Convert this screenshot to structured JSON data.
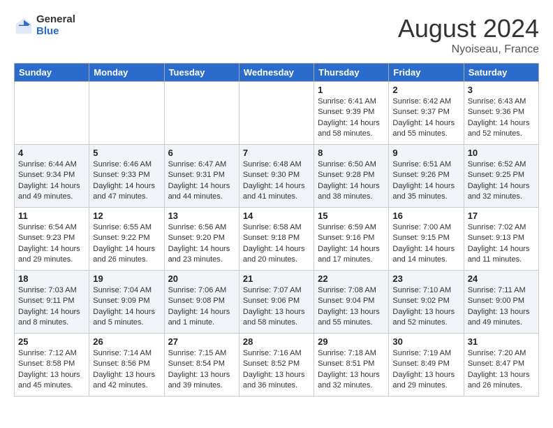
{
  "header": {
    "logo_general": "General",
    "logo_blue": "Blue",
    "month_year": "August 2024",
    "location": "Nyoiseau, France"
  },
  "weekdays": [
    "Sunday",
    "Monday",
    "Tuesday",
    "Wednesday",
    "Thursday",
    "Friday",
    "Saturday"
  ],
  "weeks": [
    [
      {
        "day": "",
        "info": ""
      },
      {
        "day": "",
        "info": ""
      },
      {
        "day": "",
        "info": ""
      },
      {
        "day": "",
        "info": ""
      },
      {
        "day": "1",
        "info": "Sunrise: 6:41 AM\nSunset: 9:39 PM\nDaylight: 14 hours\nand 58 minutes."
      },
      {
        "day": "2",
        "info": "Sunrise: 6:42 AM\nSunset: 9:37 PM\nDaylight: 14 hours\nand 55 minutes."
      },
      {
        "day": "3",
        "info": "Sunrise: 6:43 AM\nSunset: 9:36 PM\nDaylight: 14 hours\nand 52 minutes."
      }
    ],
    [
      {
        "day": "4",
        "info": "Sunrise: 6:44 AM\nSunset: 9:34 PM\nDaylight: 14 hours\nand 49 minutes."
      },
      {
        "day": "5",
        "info": "Sunrise: 6:46 AM\nSunset: 9:33 PM\nDaylight: 14 hours\nand 47 minutes."
      },
      {
        "day": "6",
        "info": "Sunrise: 6:47 AM\nSunset: 9:31 PM\nDaylight: 14 hours\nand 44 minutes."
      },
      {
        "day": "7",
        "info": "Sunrise: 6:48 AM\nSunset: 9:30 PM\nDaylight: 14 hours\nand 41 minutes."
      },
      {
        "day": "8",
        "info": "Sunrise: 6:50 AM\nSunset: 9:28 PM\nDaylight: 14 hours\nand 38 minutes."
      },
      {
        "day": "9",
        "info": "Sunrise: 6:51 AM\nSunset: 9:26 PM\nDaylight: 14 hours\nand 35 minutes."
      },
      {
        "day": "10",
        "info": "Sunrise: 6:52 AM\nSunset: 9:25 PM\nDaylight: 14 hours\nand 32 minutes."
      }
    ],
    [
      {
        "day": "11",
        "info": "Sunrise: 6:54 AM\nSunset: 9:23 PM\nDaylight: 14 hours\nand 29 minutes."
      },
      {
        "day": "12",
        "info": "Sunrise: 6:55 AM\nSunset: 9:22 PM\nDaylight: 14 hours\nand 26 minutes."
      },
      {
        "day": "13",
        "info": "Sunrise: 6:56 AM\nSunset: 9:20 PM\nDaylight: 14 hours\nand 23 minutes."
      },
      {
        "day": "14",
        "info": "Sunrise: 6:58 AM\nSunset: 9:18 PM\nDaylight: 14 hours\nand 20 minutes."
      },
      {
        "day": "15",
        "info": "Sunrise: 6:59 AM\nSunset: 9:16 PM\nDaylight: 14 hours\nand 17 minutes."
      },
      {
        "day": "16",
        "info": "Sunrise: 7:00 AM\nSunset: 9:15 PM\nDaylight: 14 hours\nand 14 minutes."
      },
      {
        "day": "17",
        "info": "Sunrise: 7:02 AM\nSunset: 9:13 PM\nDaylight: 14 hours\nand 11 minutes."
      }
    ],
    [
      {
        "day": "18",
        "info": "Sunrise: 7:03 AM\nSunset: 9:11 PM\nDaylight: 14 hours\nand 8 minutes."
      },
      {
        "day": "19",
        "info": "Sunrise: 7:04 AM\nSunset: 9:09 PM\nDaylight: 14 hours\nand 5 minutes."
      },
      {
        "day": "20",
        "info": "Sunrise: 7:06 AM\nSunset: 9:08 PM\nDaylight: 14 hours\nand 1 minute."
      },
      {
        "day": "21",
        "info": "Sunrise: 7:07 AM\nSunset: 9:06 PM\nDaylight: 13 hours\nand 58 minutes."
      },
      {
        "day": "22",
        "info": "Sunrise: 7:08 AM\nSunset: 9:04 PM\nDaylight: 13 hours\nand 55 minutes."
      },
      {
        "day": "23",
        "info": "Sunrise: 7:10 AM\nSunset: 9:02 PM\nDaylight: 13 hours\nand 52 minutes."
      },
      {
        "day": "24",
        "info": "Sunrise: 7:11 AM\nSunset: 9:00 PM\nDaylight: 13 hours\nand 49 minutes."
      }
    ],
    [
      {
        "day": "25",
        "info": "Sunrise: 7:12 AM\nSunset: 8:58 PM\nDaylight: 13 hours\nand 45 minutes."
      },
      {
        "day": "26",
        "info": "Sunrise: 7:14 AM\nSunset: 8:56 PM\nDaylight: 13 hours\nand 42 minutes."
      },
      {
        "day": "27",
        "info": "Sunrise: 7:15 AM\nSunset: 8:54 PM\nDaylight: 13 hours\nand 39 minutes."
      },
      {
        "day": "28",
        "info": "Sunrise: 7:16 AM\nSunset: 8:52 PM\nDaylight: 13 hours\nand 36 minutes."
      },
      {
        "day": "29",
        "info": "Sunrise: 7:18 AM\nSunset: 8:51 PM\nDaylight: 13 hours\nand 32 minutes."
      },
      {
        "day": "30",
        "info": "Sunrise: 7:19 AM\nSunset: 8:49 PM\nDaylight: 13 hours\nand 29 minutes."
      },
      {
        "day": "31",
        "info": "Sunrise: 7:20 AM\nSunset: 8:47 PM\nDaylight: 13 hours\nand 26 minutes."
      }
    ]
  ]
}
